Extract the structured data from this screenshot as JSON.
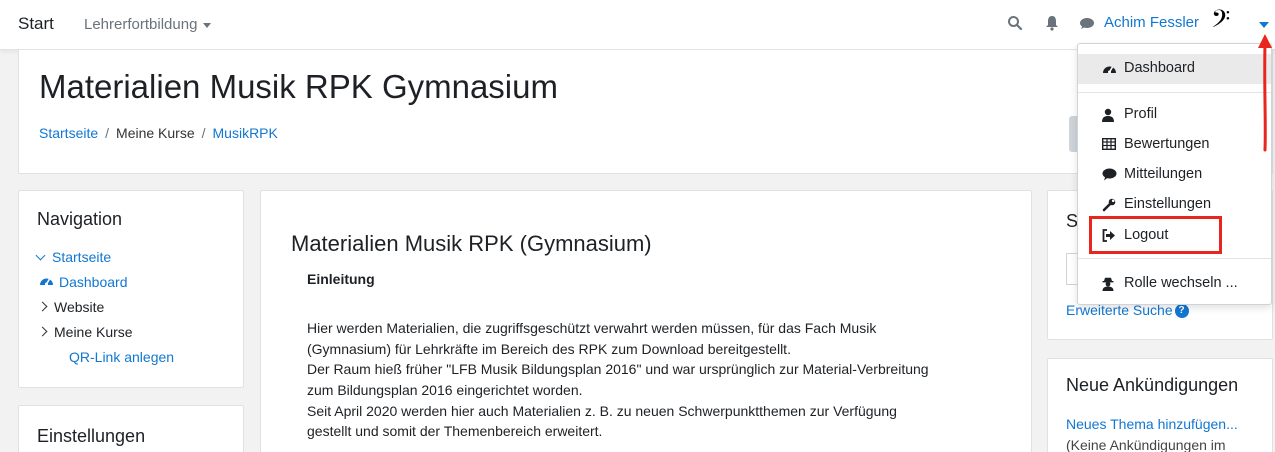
{
  "navbar": {
    "brand": "Start",
    "course_menu": "Lehrerfortbildung",
    "user_name": "Achim Fessler",
    "avatar_glyph": "𝄢",
    "icons": [
      "search-icon",
      "bell-icon",
      "chat-icon"
    ]
  },
  "header": {
    "title": "Materialien Musik RPK Gymnasium",
    "breadcrumb": [
      "Startseite",
      "Meine Kurse",
      "MusikRPK"
    ]
  },
  "navigation_block": {
    "title": "Navigation",
    "items": [
      "Startseite",
      "Dashboard",
      "Website",
      "Meine Kurse",
      "QR-Link anlegen"
    ]
  },
  "settings_block": {
    "title": "Einstellungen"
  },
  "main": {
    "title": "Materialien Musik RPK (Gymnasium)",
    "section": "Einleitung",
    "paragraph_lines": [
      "Hier werden Materialien, die zugriffsgeschützt verwahrt werden müssen, für das Fach Musik",
      "(Gymnasium) für Lehrkräfte im Bereich des RPK zum Download bereitgestellt.",
      "Der Raum hieß früher \"LFB Musik Bildungsplan 2016\" und war ursprünglich zur Material-Verbreitung",
      "zum Bildungsplan 2016 eingerichtet worden.",
      "Seit April 2020 werden hier auch Materialien z. B. zu neuen Schwerpunktthemen zur Verfügung",
      "gestellt und somit der Themenbereich erweitert."
    ]
  },
  "search_block": {
    "title_partial": "S",
    "advanced_search": "Erweiterte Suche"
  },
  "news_block": {
    "title": "Neue Ankündigungen",
    "add_topic": "Neues Thema hinzufügen...",
    "empty_text": "(Keine Ankündigungen im"
  },
  "user_menu": {
    "items": [
      {
        "label": "Dashboard",
        "icon": "dashboard-icon"
      },
      {
        "label": "Profil",
        "icon": "user-icon"
      },
      {
        "label": "Bewertungen",
        "icon": "table-icon"
      },
      {
        "label": "Mitteilungen",
        "icon": "chat-icon"
      },
      {
        "label": "Einstellungen",
        "icon": "wrench-icon"
      },
      {
        "label": "Logout",
        "icon": "logout-icon"
      },
      {
        "label": "Rolle wechseln ...",
        "icon": "user-secret-icon"
      }
    ]
  },
  "colors": {
    "link": "#1177d1",
    "annotation_red": "#e8261d"
  }
}
